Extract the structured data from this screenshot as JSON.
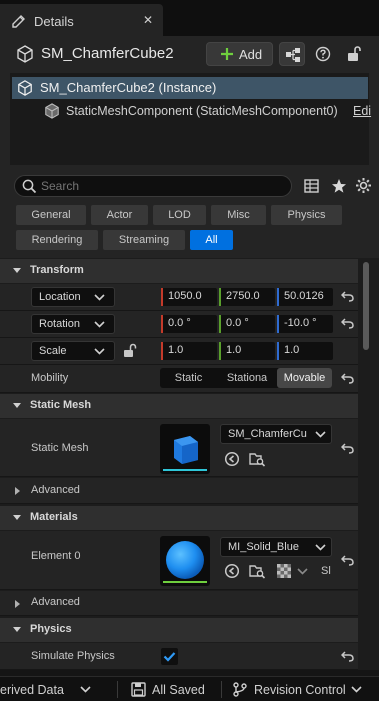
{
  "tab": {
    "title": "Details",
    "close": "✕"
  },
  "header": {
    "object_name": "SM_ChamferCube2",
    "add_label": "Add",
    "tree": {
      "instance": "SM_ChamferCube2 (Instance)",
      "component": "StaticMeshComponent (StaticMeshComponent0)",
      "edit_hint": "Edi"
    }
  },
  "search": {
    "placeholder": "Search",
    "filters_row1": [
      "General",
      "Actor",
      "LOD",
      "Misc",
      "Physics"
    ],
    "filters_row2": [
      "Rendering",
      "Streaming",
      "All"
    ],
    "active_filter": "All"
  },
  "transform": {
    "section_title": "Transform",
    "location": {
      "label": "Location",
      "x": "1050.0",
      "y": "2750.0",
      "z": "50.0126"
    },
    "rotation": {
      "label": "Rotation",
      "x": "0.0 °",
      "y": "0.0 °",
      "z": "-10.0 °"
    },
    "scale": {
      "label": "Scale",
      "x": "1.0",
      "y": "1.0",
      "z": "1.0"
    },
    "mobility": {
      "label": "Mobility",
      "options": [
        "Static",
        "Stationa",
        "Movable"
      ],
      "selected": "Movable"
    }
  },
  "static_mesh": {
    "section_title": "Static Mesh",
    "label": "Static Mesh",
    "asset": "SM_ChamferCu",
    "advanced": "Advanced"
  },
  "materials": {
    "section_title": "Materials",
    "label": "Element 0",
    "asset": "MI_Solid_Blue",
    "extra": "Sl",
    "advanced": "Advanced"
  },
  "physics": {
    "section_title": "Physics",
    "simulate_label": "Simulate Physics",
    "simulate_checked": true
  },
  "statusbar": {
    "derived": "erived Data",
    "saved": "All Saved",
    "revision": "Revision Control"
  },
  "colors": {
    "accent": "#0070e0",
    "selection": "#3e5567",
    "axis_x": "#c43a2a",
    "axis_y": "#5aa02c",
    "axis_z": "#2f6bd0",
    "add_icon": "#6fcf3e"
  }
}
